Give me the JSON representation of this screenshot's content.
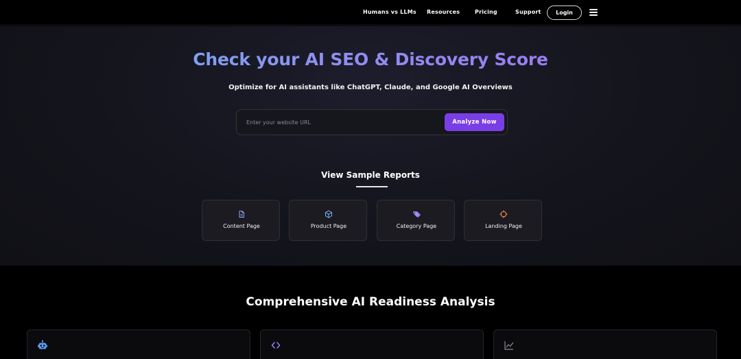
{
  "nav": {
    "links": [
      "Humans vs LLMs",
      "Resources",
      "Pricing",
      "Support"
    ],
    "login_label": "Login",
    "menu_icon": "hamburger-menu-icon"
  },
  "hero": {
    "title": "Check your AI SEO & Discovery Score",
    "subtitle": "Optimize for AI assistants like ChatGPT, Claude, and Google AI Overviews",
    "url_input": {
      "placeholder": "Enter your website URL",
      "value": ""
    },
    "analyze_label": "Analyze Now",
    "accent_color": "#7a3ee6"
  },
  "samples": {
    "title": "View Sample Reports",
    "cards": [
      {
        "label": "Content Page",
        "icon": "document-icon",
        "icon_color": "#8fa4ff"
      },
      {
        "label": "Product Page",
        "icon": "cube-icon",
        "icon_color": "#7fb5ff"
      },
      {
        "label": "Category Page",
        "icon": "tags-icon",
        "icon_color": "#a98bff"
      },
      {
        "label": "Landing Page",
        "icon": "crosshair-icon",
        "icon_color": "#f08a4b"
      }
    ]
  },
  "features": {
    "title": "Comprehensive AI Readiness Analysis",
    "cards": [
      {
        "icon": "robot-icon",
        "icon_color": "#5b9cf2"
      },
      {
        "icon": "code-icon",
        "icon_color": "#9b7df2"
      },
      {
        "icon": "chart-line-icon",
        "icon_color": "#8a8a94"
      }
    ]
  }
}
